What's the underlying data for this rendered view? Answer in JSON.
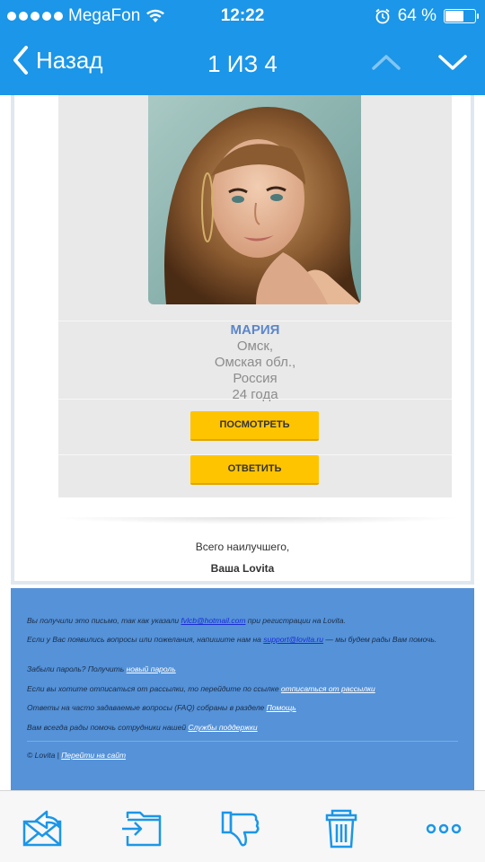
{
  "status_bar": {
    "carrier": "MegaFon",
    "time": "12:22",
    "battery_percent": "64 %",
    "battery_level": 0.64
  },
  "nav": {
    "back_label": "Назад",
    "counter": "1 ИЗ 4"
  },
  "profile": {
    "name": "МАРИЯ",
    "city": "Омск,",
    "region": "Омская обл.,",
    "country": "Россия",
    "age": "24 года",
    "view_button": "ПОСМОТРЕТЬ",
    "reply_button": "ОТВЕТИТЬ"
  },
  "signoff": {
    "line1": "Всего наилучшего,",
    "line2": "Ваша Lovita"
  },
  "footer": {
    "p1_text": "Вы получили это письмо, так как указали ",
    "p1_email": "fvlcb@hotmail.com",
    "p1_tail": " при регистрации на Lovita.",
    "p2_text": "Если у Вас появились вопросы или пожелания, напишите нам на ",
    "p2_email": "support@lovita.ru",
    "p2_tail": " — мы будем рады Вам помочь.",
    "p3_text": "Забыли пароль? Получить ",
    "p3_link": "новый пароль",
    "p4_text": "Если вы хотите отписаться от рассылки, то перейдите по ссылке ",
    "p4_link": "отписаться от рассылки",
    "p5_text": "Ответы на часто задаваемые вопросы (FAQ) собраны в разделе ",
    "p5_link": "Помощь",
    "p6_text": "Вам всегда рады помочь сотрудники нашей ",
    "p6_link": "Службы поддержки",
    "p7_text": "© Lovita | ",
    "p7_link": "Перейти на сайт"
  },
  "toolbar_icons": [
    "mail-reply-icon",
    "move-to-folder-icon",
    "thumbs-down-icon",
    "trash-icon",
    "more-icon"
  ],
  "colors": {
    "accent": "#1b96e8",
    "button": "#ffc400",
    "footer": "#5592d8",
    "name": "#5c86c9"
  }
}
